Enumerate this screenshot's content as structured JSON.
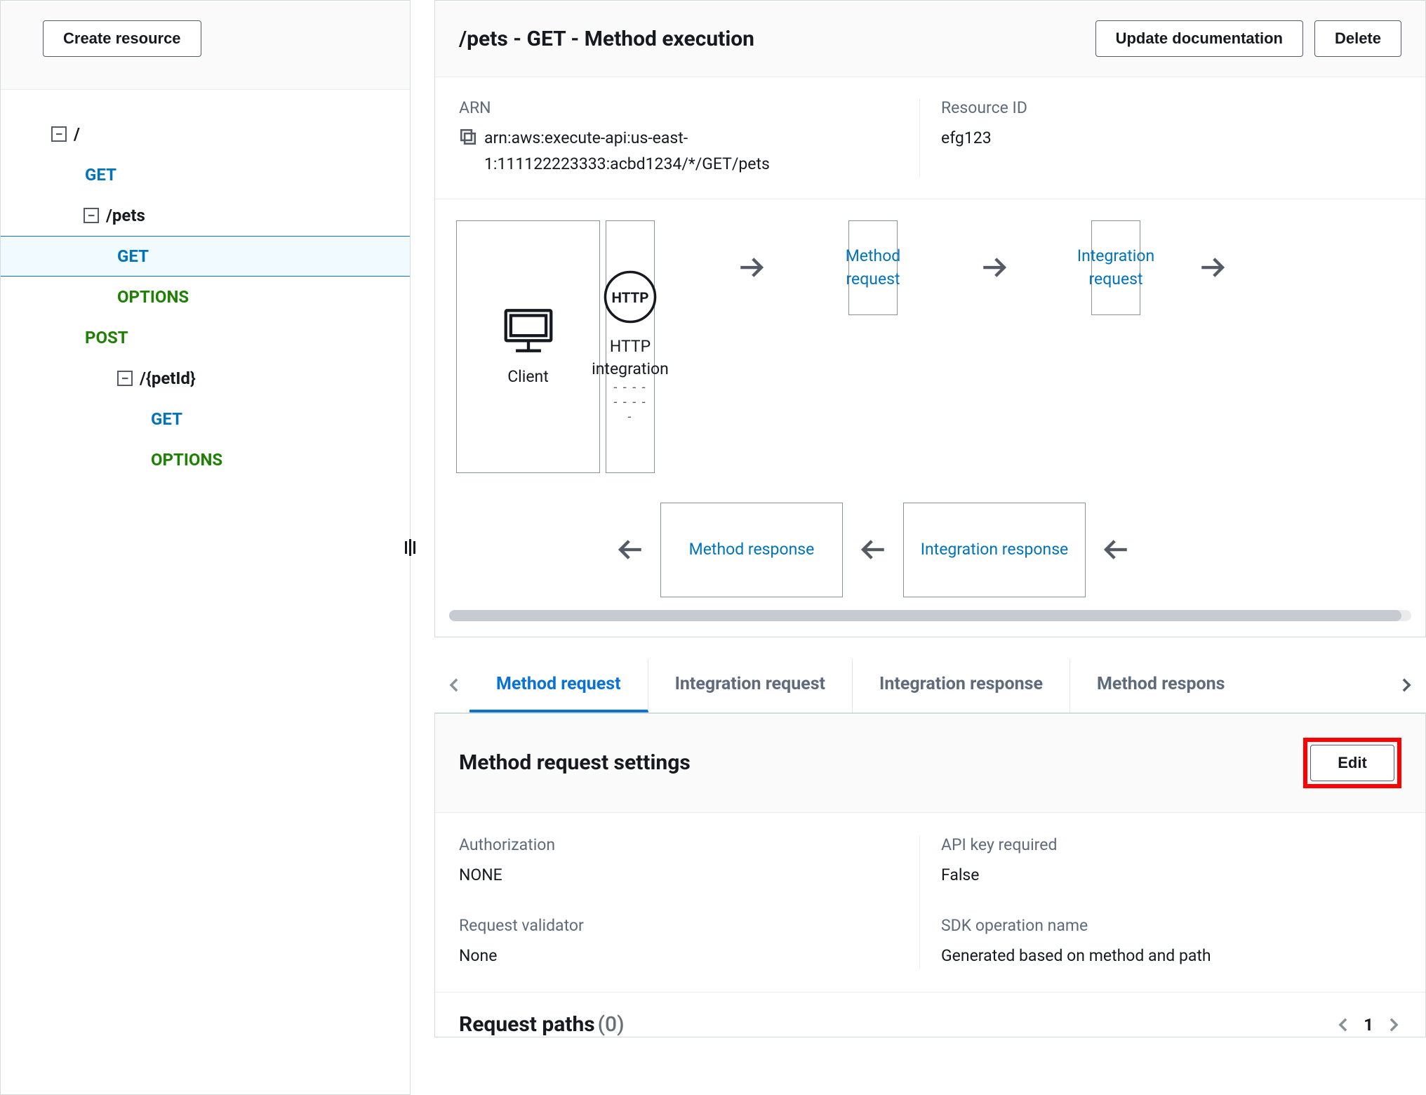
{
  "sidebar": {
    "create_resource": "Create resource",
    "tree": {
      "root": "/",
      "root_get": "GET",
      "pets": "/pets",
      "pets_get": "GET",
      "pets_options": "OPTIONS",
      "pets_post": "POST",
      "petid": "/{petId}",
      "petid_get": "GET",
      "petid_options": "OPTIONS"
    }
  },
  "header": {
    "title": "/pets - GET - Method execution",
    "update_doc": "Update documentation",
    "delete": "Delete"
  },
  "info": {
    "arn_label": "ARN",
    "arn_value": "arn:aws:execute-api:us-east-1:111122223333:acbd1234/*/GET/pets",
    "resource_id_label": "Resource ID",
    "resource_id_value": "efg123"
  },
  "flow": {
    "client": "Client",
    "method_request": "Method request",
    "integration_request": "Integration request",
    "http_top": "HTTP",
    "http_mid": "HTTP integration",
    "method_response": "Method response",
    "integration_response": "Integration response"
  },
  "tabs": {
    "method_request": "Method request",
    "integration_request": "Integration request",
    "integration_response": "Integration response",
    "method_response": "Method respons"
  },
  "settings": {
    "title": "Method request settings",
    "edit": "Edit",
    "authorization_label": "Authorization",
    "authorization_value": "NONE",
    "api_key_label": "API key required",
    "api_key_value": "False",
    "validator_label": "Request validator",
    "validator_value": "None",
    "sdk_label": "SDK operation name",
    "sdk_value": "Generated based on method and path"
  },
  "paths": {
    "title": "Request paths ",
    "count": "(0)",
    "page": "1"
  }
}
